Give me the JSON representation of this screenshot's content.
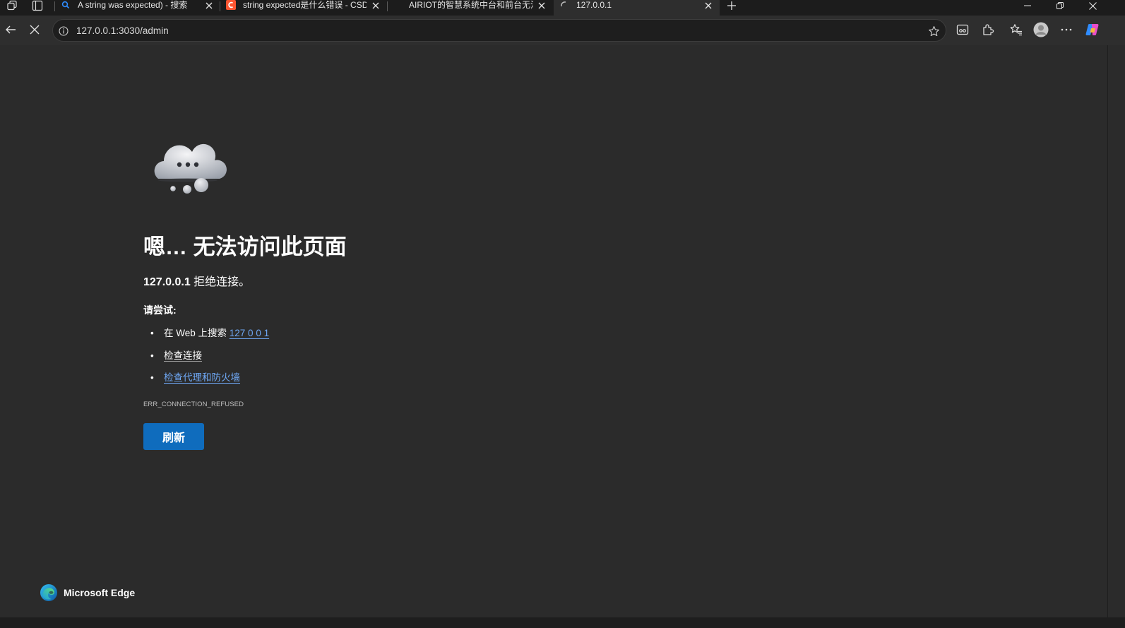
{
  "tabs": [
    {
      "title": "A string was expected) - 搜索",
      "favicon": "search-icon",
      "active": false
    },
    {
      "title": "string expected是什么错误 - CSDN",
      "favicon": "csdn-logo-icon",
      "active": false
    },
    {
      "title": "AIRIOT的智慧系统中台和前台无法",
      "favicon": "",
      "active": false
    },
    {
      "title": "127.0.0.1",
      "favicon": "loading-spinner-icon",
      "active": true
    }
  ],
  "address_bar": {
    "url": "127.0.0.1:3030/admin"
  },
  "error_page": {
    "title": "嗯… 无法访问此页面",
    "host": "127.0.0.1",
    "message": " 拒绝连接。",
    "try_label": "请尝试:",
    "suggestions": {
      "search_prefix": "在 Web 上搜索 ",
      "search_link": "127 0 0 1",
      "check_connection": "检查连接",
      "check_proxy": "检查代理和防火墙"
    },
    "error_code": "ERR_CONNECTION_REFUSED",
    "refresh_label": "刷新"
  },
  "branding": {
    "name": "Microsoft Edge"
  },
  "colors": {
    "background": "#2b2b2b",
    "link": "#6fa8f5",
    "button": "#0f6cbd"
  }
}
